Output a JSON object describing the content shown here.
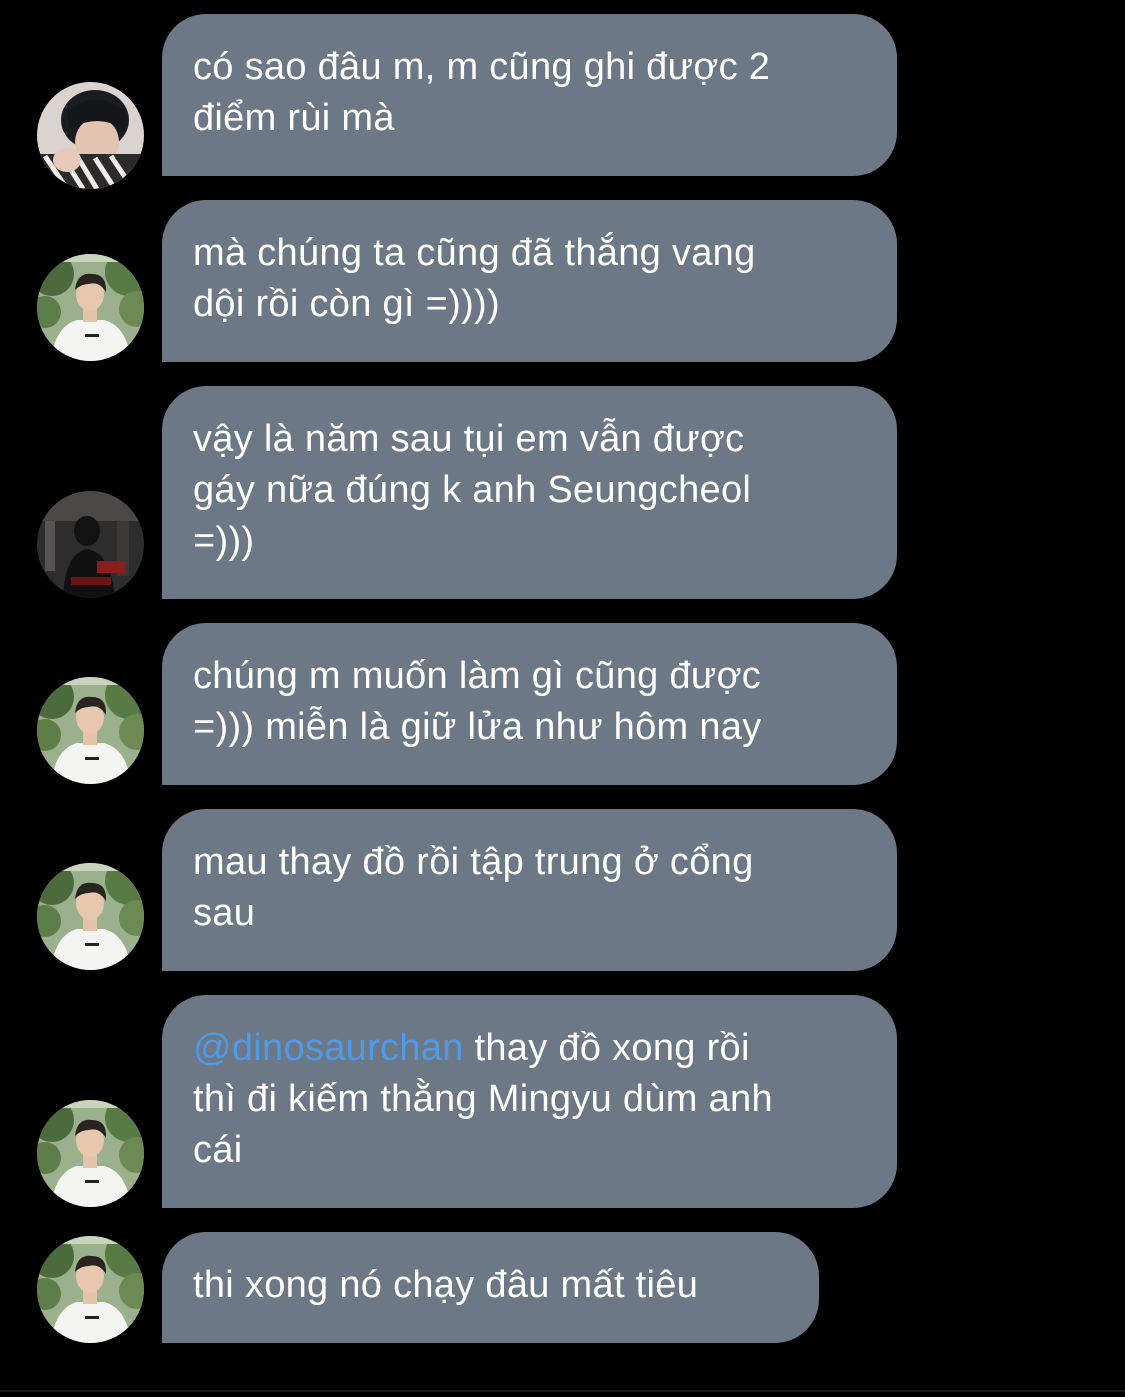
{
  "messages": [
    {
      "avatar": "user-avatar-dark-hair",
      "lines": [
        "có sao đâu m, m cũng ghi được 2",
        "điểm rùi mà"
      ]
    },
    {
      "avatar": "user-avatar-white-shirt",
      "lines": [
        "mà chúng ta cũng đã thắng vang",
        "dội rồi còn gì =))))"
      ]
    },
    {
      "avatar": "user-avatar-dark-photo",
      "lines": [
        "vậy là năm sau tụi em vẫn được",
        "gáy nữa đúng k anh Seungcheol",
        "=)))"
      ]
    },
    {
      "avatar": "user-avatar-white-shirt",
      "lines": [
        "chúng m muốn làm gì cũng được",
        "=))) miễn là giữ lửa như hôm nay"
      ]
    },
    {
      "avatar": "user-avatar-white-shirt",
      "lines": [
        "mau thay đồ rồi tập trung ở cổng",
        "sau"
      ]
    },
    {
      "avatar": "user-avatar-white-shirt",
      "mention": "@dinosaurchan",
      "lines": [
        " thay đồ xong rồi",
        "thì đi kiếm thằng Mingyu dùm anh",
        "cái"
      ]
    },
    {
      "avatar": "user-avatar-white-shirt",
      "lines": [
        "thi xong nó chạy đâu mất tiêu"
      ]
    }
  ],
  "colors": {
    "background": "#000000",
    "bubble": "#6c7886",
    "text": "#ffffff",
    "mention": "#4f9be8"
  }
}
